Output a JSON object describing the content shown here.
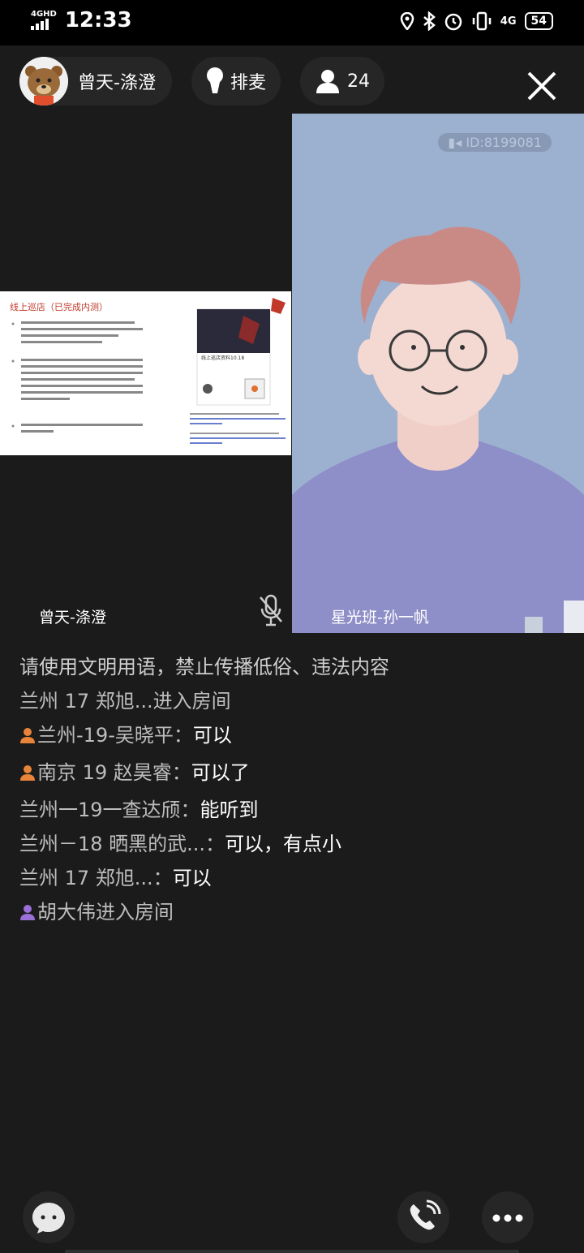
{
  "status_bar": {
    "network": "4GHD",
    "time": "12:33",
    "net_right": "4G",
    "battery": "54"
  },
  "header": {
    "host_name": "曾天-涤澄",
    "queue_label": "排麦",
    "viewer_count": "24"
  },
  "videos": {
    "left_name": "曾天-涤澄",
    "right_name": "星光班-孙一帆",
    "id_badge": "ID:8199081"
  },
  "slide": {
    "title": "线上巡店（已完成内测）",
    "card_title": "线上巡店资料10.18"
  },
  "chat": {
    "notice": "请使用文明用语，禁止传播低俗、违法内容",
    "messages": [
      {
        "user": "兰州  17  郑旭...进入房间",
        "text": "",
        "icon": "none"
      },
      {
        "user": "兰州-19-吴晓平：",
        "text": "可以",
        "icon": "user-orange-icon"
      },
      {
        "user": "南京 19 赵昊睿：",
        "text": "可以了",
        "icon": "user-orange-icon"
      },
      {
        "user": "兰州一19一查达颀：",
        "text": "能听到",
        "icon": "none"
      },
      {
        "user": "兰州－18 晒黑的武...：",
        "text": "可以，有点小",
        "icon": "none"
      },
      {
        "user": "兰州  17  郑旭...：",
        "text": "可以",
        "icon": "none"
      },
      {
        "user": "胡大伟进入房间",
        "text": "",
        "icon": "user-purple-icon"
      }
    ]
  },
  "colors": {
    "background": "#1b1b1b",
    "pill": "#262626",
    "video_bg": "#9cb0cf",
    "shirt": "#8e8ec8",
    "hair": "#c98a86"
  }
}
